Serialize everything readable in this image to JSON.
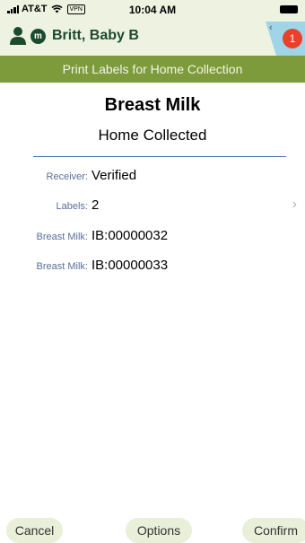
{
  "status_bar": {
    "carrier": "AT&T",
    "vpn": "VPN",
    "time": "10:04 AM"
  },
  "patient": {
    "badge_letter": "m",
    "name": "Britt, Baby B"
  },
  "notification_count": "1",
  "nav_title": "Print Labels for Home Collection",
  "title": "Breast Milk",
  "subtitle": "Home Collected",
  "fields": [
    {
      "label": "Receiver:",
      "value": "Verified"
    },
    {
      "label": "Labels:",
      "value": "2"
    },
    {
      "label": "Breast Milk:",
      "value": "IB:00000032"
    },
    {
      "label": "Breast Milk:",
      "value": "IB:00000033"
    }
  ],
  "buttons": {
    "cancel": "Cancel",
    "options": "Options",
    "confirm": "Confirm"
  },
  "colors": {
    "title_bar": "#7d9b3a",
    "header_bg": "#eef3e1",
    "patient_text": "#1c4a2e",
    "notification": "#e8412b",
    "label_text": "#5a6f99",
    "button_bg": "#e9efd9"
  }
}
